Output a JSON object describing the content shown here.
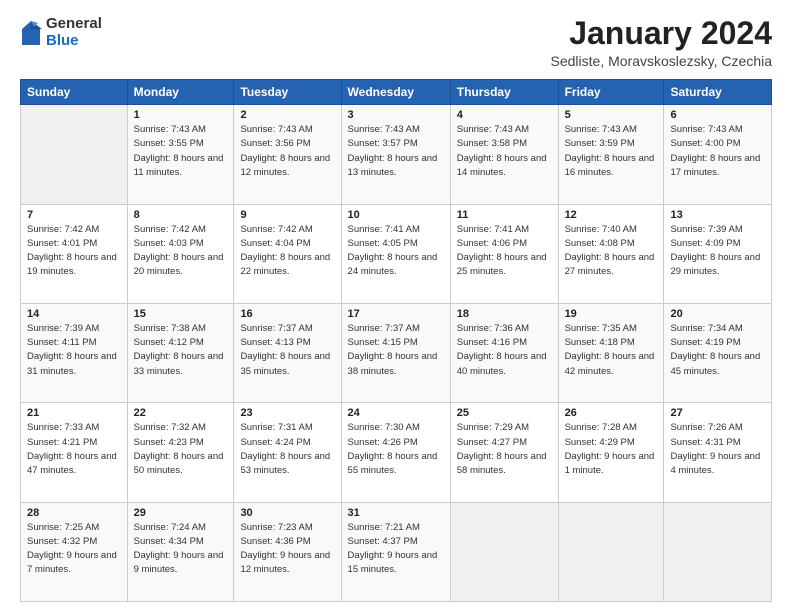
{
  "logo": {
    "general": "General",
    "blue": "Blue"
  },
  "title": "January 2024",
  "location": "Sedliste, Moravskoslezsky, Czechia",
  "days_of_week": [
    "Sunday",
    "Monday",
    "Tuesday",
    "Wednesday",
    "Thursday",
    "Friday",
    "Saturday"
  ],
  "weeks": [
    [
      {
        "day": "",
        "sunrise": "",
        "sunset": "",
        "daylight": ""
      },
      {
        "day": "1",
        "sunrise": "Sunrise: 7:43 AM",
        "sunset": "Sunset: 3:55 PM",
        "daylight": "Daylight: 8 hours and 11 minutes."
      },
      {
        "day": "2",
        "sunrise": "Sunrise: 7:43 AM",
        "sunset": "Sunset: 3:56 PM",
        "daylight": "Daylight: 8 hours and 12 minutes."
      },
      {
        "day": "3",
        "sunrise": "Sunrise: 7:43 AM",
        "sunset": "Sunset: 3:57 PM",
        "daylight": "Daylight: 8 hours and 13 minutes."
      },
      {
        "day": "4",
        "sunrise": "Sunrise: 7:43 AM",
        "sunset": "Sunset: 3:58 PM",
        "daylight": "Daylight: 8 hours and 14 minutes."
      },
      {
        "day": "5",
        "sunrise": "Sunrise: 7:43 AM",
        "sunset": "Sunset: 3:59 PM",
        "daylight": "Daylight: 8 hours and 16 minutes."
      },
      {
        "day": "6",
        "sunrise": "Sunrise: 7:43 AM",
        "sunset": "Sunset: 4:00 PM",
        "daylight": "Daylight: 8 hours and 17 minutes."
      }
    ],
    [
      {
        "day": "7",
        "sunrise": "Sunrise: 7:42 AM",
        "sunset": "Sunset: 4:01 PM",
        "daylight": "Daylight: 8 hours and 19 minutes."
      },
      {
        "day": "8",
        "sunrise": "Sunrise: 7:42 AM",
        "sunset": "Sunset: 4:03 PM",
        "daylight": "Daylight: 8 hours and 20 minutes."
      },
      {
        "day": "9",
        "sunrise": "Sunrise: 7:42 AM",
        "sunset": "Sunset: 4:04 PM",
        "daylight": "Daylight: 8 hours and 22 minutes."
      },
      {
        "day": "10",
        "sunrise": "Sunrise: 7:41 AM",
        "sunset": "Sunset: 4:05 PM",
        "daylight": "Daylight: 8 hours and 24 minutes."
      },
      {
        "day": "11",
        "sunrise": "Sunrise: 7:41 AM",
        "sunset": "Sunset: 4:06 PM",
        "daylight": "Daylight: 8 hours and 25 minutes."
      },
      {
        "day": "12",
        "sunrise": "Sunrise: 7:40 AM",
        "sunset": "Sunset: 4:08 PM",
        "daylight": "Daylight: 8 hours and 27 minutes."
      },
      {
        "day": "13",
        "sunrise": "Sunrise: 7:39 AM",
        "sunset": "Sunset: 4:09 PM",
        "daylight": "Daylight: 8 hours and 29 minutes."
      }
    ],
    [
      {
        "day": "14",
        "sunrise": "Sunrise: 7:39 AM",
        "sunset": "Sunset: 4:11 PM",
        "daylight": "Daylight: 8 hours and 31 minutes."
      },
      {
        "day": "15",
        "sunrise": "Sunrise: 7:38 AM",
        "sunset": "Sunset: 4:12 PM",
        "daylight": "Daylight: 8 hours and 33 minutes."
      },
      {
        "day": "16",
        "sunrise": "Sunrise: 7:37 AM",
        "sunset": "Sunset: 4:13 PM",
        "daylight": "Daylight: 8 hours and 35 minutes."
      },
      {
        "day": "17",
        "sunrise": "Sunrise: 7:37 AM",
        "sunset": "Sunset: 4:15 PM",
        "daylight": "Daylight: 8 hours and 38 minutes."
      },
      {
        "day": "18",
        "sunrise": "Sunrise: 7:36 AM",
        "sunset": "Sunset: 4:16 PM",
        "daylight": "Daylight: 8 hours and 40 minutes."
      },
      {
        "day": "19",
        "sunrise": "Sunrise: 7:35 AM",
        "sunset": "Sunset: 4:18 PM",
        "daylight": "Daylight: 8 hours and 42 minutes."
      },
      {
        "day": "20",
        "sunrise": "Sunrise: 7:34 AM",
        "sunset": "Sunset: 4:19 PM",
        "daylight": "Daylight: 8 hours and 45 minutes."
      }
    ],
    [
      {
        "day": "21",
        "sunrise": "Sunrise: 7:33 AM",
        "sunset": "Sunset: 4:21 PM",
        "daylight": "Daylight: 8 hours and 47 minutes."
      },
      {
        "day": "22",
        "sunrise": "Sunrise: 7:32 AM",
        "sunset": "Sunset: 4:23 PM",
        "daylight": "Daylight: 8 hours and 50 minutes."
      },
      {
        "day": "23",
        "sunrise": "Sunrise: 7:31 AM",
        "sunset": "Sunset: 4:24 PM",
        "daylight": "Daylight: 8 hours and 53 minutes."
      },
      {
        "day": "24",
        "sunrise": "Sunrise: 7:30 AM",
        "sunset": "Sunset: 4:26 PM",
        "daylight": "Daylight: 8 hours and 55 minutes."
      },
      {
        "day": "25",
        "sunrise": "Sunrise: 7:29 AM",
        "sunset": "Sunset: 4:27 PM",
        "daylight": "Daylight: 8 hours and 58 minutes."
      },
      {
        "day": "26",
        "sunrise": "Sunrise: 7:28 AM",
        "sunset": "Sunset: 4:29 PM",
        "daylight": "Daylight: 9 hours and 1 minute."
      },
      {
        "day": "27",
        "sunrise": "Sunrise: 7:26 AM",
        "sunset": "Sunset: 4:31 PM",
        "daylight": "Daylight: 9 hours and 4 minutes."
      }
    ],
    [
      {
        "day": "28",
        "sunrise": "Sunrise: 7:25 AM",
        "sunset": "Sunset: 4:32 PM",
        "daylight": "Daylight: 9 hours and 7 minutes."
      },
      {
        "day": "29",
        "sunrise": "Sunrise: 7:24 AM",
        "sunset": "Sunset: 4:34 PM",
        "daylight": "Daylight: 9 hours and 9 minutes."
      },
      {
        "day": "30",
        "sunrise": "Sunrise: 7:23 AM",
        "sunset": "Sunset: 4:36 PM",
        "daylight": "Daylight: 9 hours and 12 minutes."
      },
      {
        "day": "31",
        "sunrise": "Sunrise: 7:21 AM",
        "sunset": "Sunset: 4:37 PM",
        "daylight": "Daylight: 9 hours and 15 minutes."
      },
      {
        "day": "",
        "sunrise": "",
        "sunset": "",
        "daylight": ""
      },
      {
        "day": "",
        "sunrise": "",
        "sunset": "",
        "daylight": ""
      },
      {
        "day": "",
        "sunrise": "",
        "sunset": "",
        "daylight": ""
      }
    ]
  ]
}
